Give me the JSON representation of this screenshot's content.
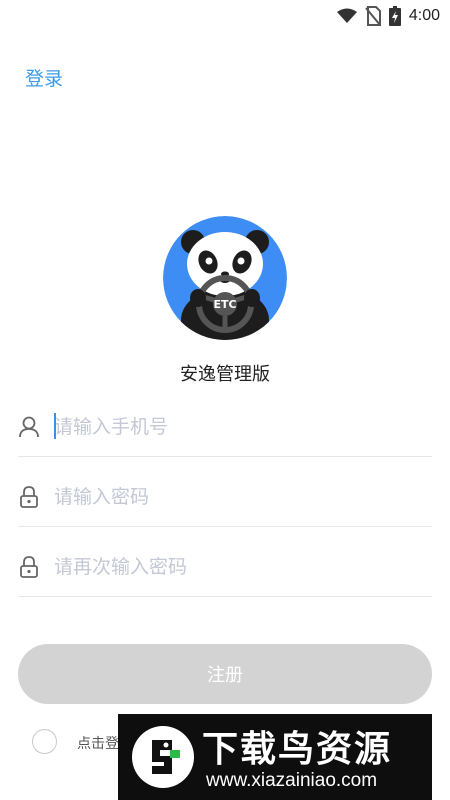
{
  "status_bar": {
    "time": "4:00",
    "icons": [
      "wifi-icon",
      "no-sim-icon",
      "battery-charging-icon"
    ]
  },
  "header": {
    "login_label": "登录"
  },
  "logo": {
    "text": "ETC",
    "colors": {
      "ring": "#3d8df5",
      "dark": "#1d1d1d",
      "light": "#ffffff"
    }
  },
  "app_name": "安逸管理版",
  "form": {
    "phone": {
      "placeholder": "请输入手机号",
      "value": "",
      "icon": "user-icon"
    },
    "password": {
      "placeholder": "请输入密码",
      "value": "",
      "icon": "lock-icon"
    },
    "confirm_password": {
      "placeholder": "请再次输入密码",
      "value": "",
      "icon": "lock-icon"
    }
  },
  "register_button": {
    "label": "注册"
  },
  "agreement": {
    "text": "点击登"
  },
  "watermark": {
    "title": "下载鸟资源",
    "url": "www.xiazainiao.com"
  },
  "colors": {
    "accent": "#3d9ae8",
    "button_disabled": "#d3d3d3",
    "placeholder": "#c4c8d6"
  }
}
